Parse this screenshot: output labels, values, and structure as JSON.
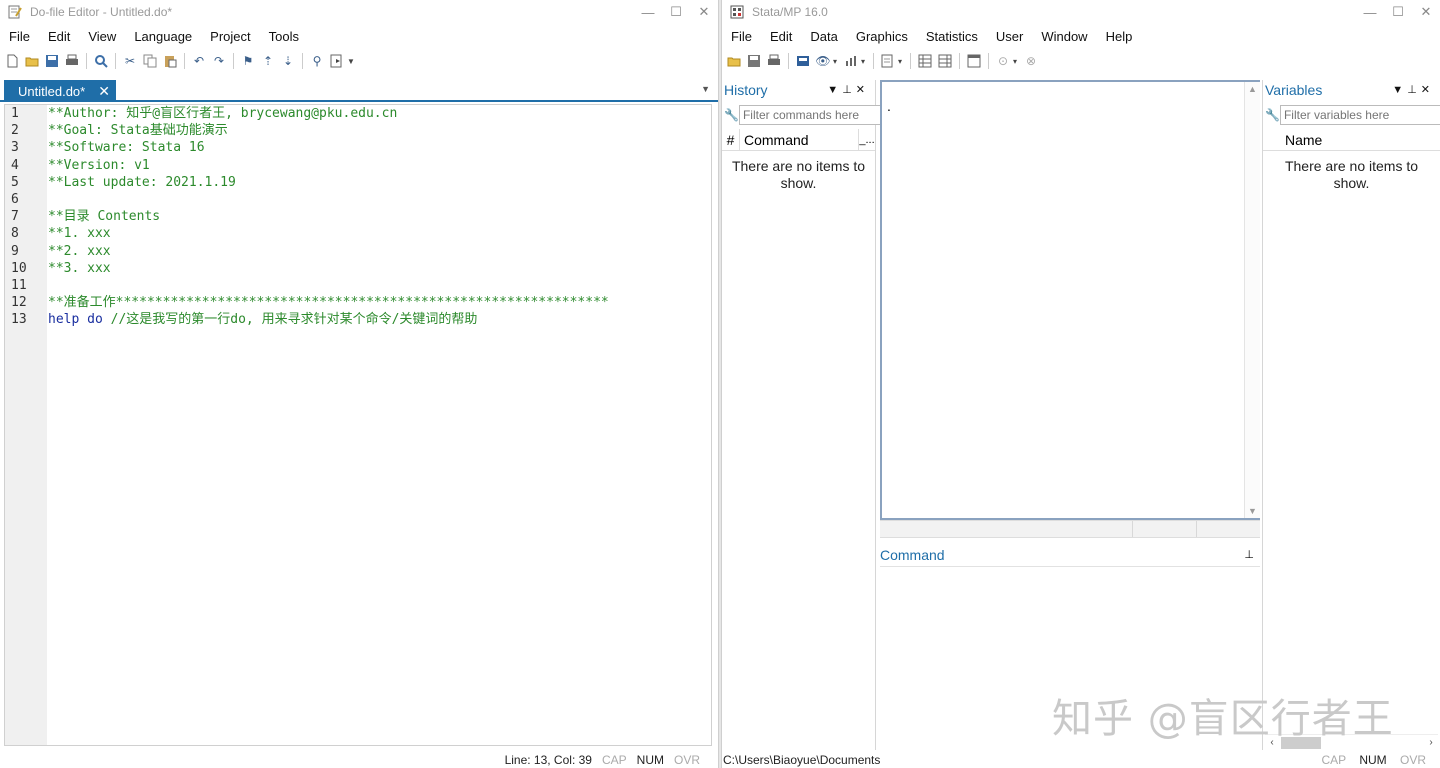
{
  "editor": {
    "title": "Do-file Editor - Untitled.do*",
    "menu": [
      "File",
      "Edit",
      "View",
      "Language",
      "Project",
      "Tools"
    ],
    "tab_label": "Untitled.do*",
    "tab_close": "✕",
    "line_numbers": [
      "1",
      "2",
      "3",
      "4",
      "5",
      "6",
      "7",
      "8",
      "9",
      "10",
      "11",
      "12",
      "13"
    ],
    "lines": [
      "**Author: 知乎@盲区行者王, brycewang@pku.edu.cn",
      "**Goal: Stata基础功能演示",
      "**Software: Stata 16",
      "**Version: v1",
      "**Last update: 2021.1.19",
      "",
      "**目录 Contents",
      "**1. xxx",
      "**2. xxx",
      "**3. xxx",
      "",
      "**准备工作***************************************************************"
    ],
    "last_line": {
      "keyword": "help do",
      "comment": " //这是我写的第一行do, 用来寻求针对某个命令/关键词的帮助"
    },
    "status": {
      "position": "Line: 13, Col: 39",
      "cap": "CAP",
      "num": "NUM",
      "ovr": "OVR"
    }
  },
  "stata": {
    "title": "Stata/MP 16.0",
    "menu": [
      "File",
      "Edit",
      "Data",
      "Graphics",
      "Statistics",
      "User",
      "Window",
      "Help"
    ],
    "history": {
      "title": "History",
      "filter_placeholder": "Filter commands here",
      "col_num": "#",
      "col_command": "Command",
      "col_extra": "_...",
      "empty": "There are no items to show."
    },
    "variables": {
      "title": "Variables",
      "filter_placeholder": "Filter variables here",
      "col_name": "Name",
      "empty": "There are no items to show."
    },
    "results": {
      "prompt": "."
    },
    "command": {
      "title": "Command"
    },
    "status": {
      "path": "C:\\Users\\Biaoyue\\Documents",
      "cap": "CAP",
      "num": "NUM",
      "ovr": "OVR"
    }
  },
  "watermark": "知乎 @盲区行者王",
  "colors": {
    "accent": "#1f6ea8",
    "comment": "#2c8a2c",
    "keyword": "#1a2fa0"
  }
}
